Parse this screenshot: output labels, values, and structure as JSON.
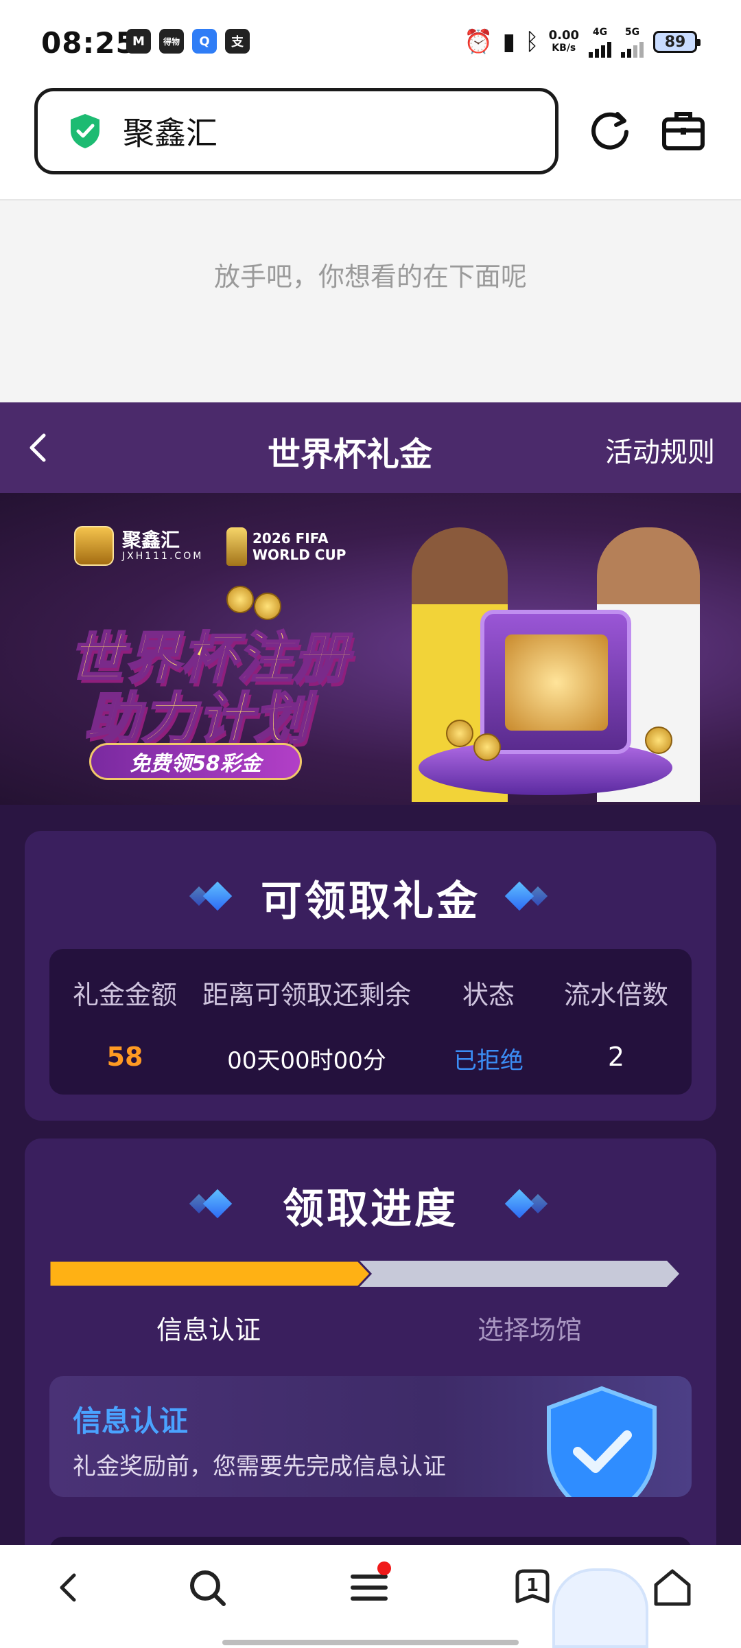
{
  "status_bar": {
    "time": "08:25",
    "app_icons": [
      "M",
      "得物",
      "Q",
      "支"
    ],
    "net_speed": "0.00",
    "net_unit": "KB/s",
    "net_4g": "4G",
    "net_5g": "5G",
    "battery": "89"
  },
  "address_bar": {
    "site_name": "聚鑫汇",
    "secure_icon": "shield-check-icon",
    "reload_icon": "reload-icon",
    "toolbox_icon": "briefcase-icon"
  },
  "pull_hint": "放手吧，你想看的在下面呢",
  "header": {
    "title": "世界杯礼金",
    "rules_link": "活动规则",
    "back_icon": "chevron-left-icon"
  },
  "banner": {
    "brand_name": "聚鑫汇",
    "brand_url": "JXH111.COM",
    "event_year": "2026 FIFA",
    "event_name": "WORLD CUP",
    "headline_line1": "世界杯注册",
    "headline_line2": "助力计划",
    "pill_text": "免费领58彩金"
  },
  "bonus_section": {
    "title": "可领取礼金",
    "columns": [
      "礼金金额",
      "距离可领取还剩余",
      "状态",
      "流水倍数"
    ],
    "row": {
      "amount": "58",
      "remaining": "00天00时00分",
      "status": "已拒绝",
      "multiplier": "2"
    }
  },
  "progress_section": {
    "title": "领取进度",
    "progress": 0.5,
    "steps": [
      "信息认证",
      "选择场馆"
    ],
    "colors": {
      "filled": "#ffb114",
      "empty": "#c7c9d9"
    },
    "info_card": {
      "title": "信息认证",
      "description": "礼金奖励前，您需要先完成信息认证"
    }
  },
  "bottom_nav": {
    "tab_count": "1",
    "items": [
      "back-icon",
      "search-icon",
      "menu-icon",
      "tabs-icon",
      "home-icon"
    ]
  },
  "colors": {
    "header_bg": "#4b2a6b",
    "page_bg": "#2a1542",
    "card_bg": "#3a1f5e",
    "accent_blue": "#3b8df5",
    "accent_orange": "#ff9a23"
  }
}
